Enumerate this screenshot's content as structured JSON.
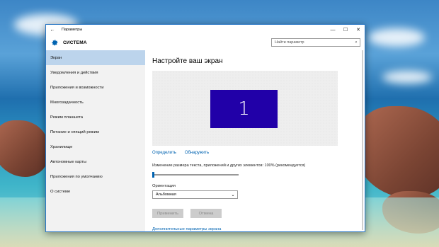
{
  "window": {
    "title": "Параметры",
    "back_icon": "back-arrow-icon",
    "controls": {
      "minimize": "—",
      "maximize": "☐",
      "close": "✕"
    }
  },
  "header": {
    "title": "СИСТЕМА",
    "icon": "gear-icon",
    "search_placeholder": "Найти параметр",
    "search_icon": "search-icon"
  },
  "sidebar": {
    "items": [
      {
        "label": "Экран",
        "active": true
      },
      {
        "label": "Уведомления и действия"
      },
      {
        "label": "Приложения и возможности"
      },
      {
        "label": "Многозадачность"
      },
      {
        "label": "Режим планшета"
      },
      {
        "label": "Питание и спящий режим"
      },
      {
        "label": "Хранилище"
      },
      {
        "label": "Автономные карты"
      },
      {
        "label": "Приложения по умолчанию"
      },
      {
        "label": "О системе"
      }
    ]
  },
  "main": {
    "title": "Настройте ваш экран",
    "monitor_number": "1",
    "identify_link": "Определить",
    "detect_link": "Обнаружить",
    "scale_label": "Изменение размера текста, приложений и других элементов: 100% (рекомендуется)",
    "scale_value_percent": 100,
    "orientation_label": "Ориентация",
    "orientation_value": "Альбомная",
    "apply_button": "Применить",
    "cancel_button": "Отмена",
    "advanced_link": "Дополнительные параметры экрана"
  },
  "colors": {
    "accent": "#0063b1",
    "monitor": "#2100a8",
    "active_nav": "#bcd4ec"
  }
}
